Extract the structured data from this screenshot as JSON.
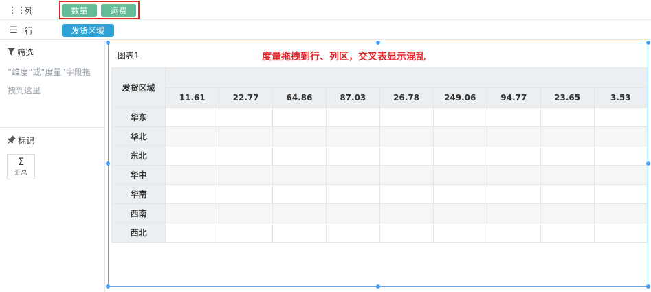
{
  "columns_bar": {
    "label": "列",
    "icon": "columns-icon",
    "fields": [
      "数量",
      "运费"
    ]
  },
  "rows_bar": {
    "label": "行",
    "icon": "rows-icon",
    "fields": [
      "发货区域"
    ]
  },
  "filter_panel": {
    "title": "筛选",
    "icon": "filter-icon",
    "hint": "“维度”或“度量”字段拖拽到这里"
  },
  "marks_panel": {
    "title": "标记",
    "icon": "pin-icon",
    "aggregate_symbol": "Σ",
    "aggregate_label": "汇总"
  },
  "chart": {
    "name": "图表1",
    "annotation": "度量拖拽到行、列区，交叉表显示混乱",
    "row_header": "发货区域",
    "column_values": [
      "11.61",
      "22.77",
      "64.86",
      "87.03",
      "26.78",
      "249.06",
      "94.77",
      "23.65",
      "3.53"
    ],
    "rows": [
      "华东",
      "华北",
      "东北",
      "华中",
      "华南",
      "西南",
      "西北"
    ]
  },
  "colors": {
    "measure_pill": "#62bd97",
    "dimension_pill": "#2ea3d6",
    "highlight": "#e0282b",
    "selection": "#4a9ff5"
  }
}
